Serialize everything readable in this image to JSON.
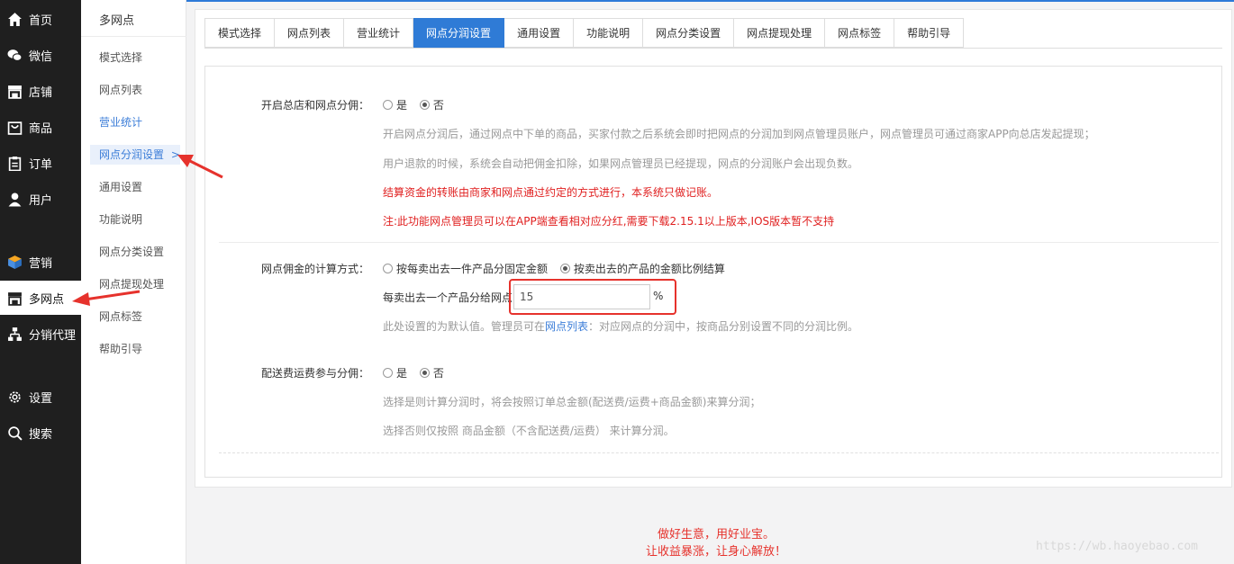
{
  "sidebar": {
    "items": [
      {
        "label": "首页",
        "icon": "home-icon"
      },
      {
        "label": "微信",
        "icon": "wechat-icon"
      },
      {
        "label": "店铺",
        "icon": "store-icon"
      },
      {
        "label": "商品",
        "icon": "shopping-bag-icon"
      },
      {
        "label": "订单",
        "icon": "clipboard-icon"
      },
      {
        "label": "用户",
        "icon": "user-icon"
      },
      {
        "label": "营销",
        "icon": "cube-icon"
      },
      {
        "label": "多网点",
        "icon": "shop-front-icon"
      },
      {
        "label": "分销代理",
        "icon": "org-chart-icon"
      },
      {
        "label": "设置",
        "icon": "gear-icon"
      },
      {
        "label": "搜索",
        "icon": "search-icon"
      }
    ]
  },
  "submenu": {
    "title": "多网点",
    "items": [
      "模式选择",
      "网点列表",
      "营业统计",
      "网点分润设置",
      "通用设置",
      "功能说明",
      "网点分类设置",
      "网点提现处理",
      "网点标签",
      "帮助引导"
    ],
    "active_marker": ">"
  },
  "tabs": [
    "模式选择",
    "网点列表",
    "营业统计",
    "网点分润设置",
    "通用设置",
    "功能说明",
    "网点分类设置",
    "网点提现处理",
    "网点标签",
    "帮助引导"
  ],
  "form": {
    "sec1": {
      "label": "开启总店和网点分佣：",
      "opt_yes": "是",
      "opt_no": "否",
      "hint1": "开启网点分润后，通过网点中下单的商品，买家付款之后系统会即时把网点的分润加到网点管理员账户，网点管理员可通过商家APP向总店发起提现；",
      "hint2": "用户退款的时候，系统会自动把佣金扣除，如果网点管理员已经提现，网点的分润账户会出现负数。",
      "warn1": "结算资金的转账由商家和网点通过约定的方式进行，本系统只做记账。",
      "warn2": "注:此功能网点管理员可以在APP端查看相对应分红,需要下载2.15.1以上版本,IOS版本暂不支持"
    },
    "sec2": {
      "label": "网点佣金的计算方式：",
      "opt_fixed": "按每卖出去一件产品分固定金额",
      "opt_ratio": "按卖出去的产品的金额比例结算",
      "input_label": "每卖出去一个产品分给网点",
      "input_value": "15",
      "unit": "%",
      "hint_pre": "此处设置的为默认值。管理员可在",
      "hint_link": "网点列表",
      "hint_post": "：对应网点的分润中，按商品分别设置不同的分润比例。"
    },
    "sec3": {
      "label": "配送费运费参与分佣：",
      "opt_yes": "是",
      "opt_no": "否",
      "hint1": "选择是则计算分润时，将会按照订单总金额(配送费/运费+商品金额)来算分润；",
      "hint2": "选择否则仅按照 商品金额（不含配送费/运费） 来计算分润。"
    }
  },
  "footer": {
    "line1": "做好生意，用好业宝。",
    "line2": "让收益暴涨，让身心解放！"
  },
  "watermark": "https://wb.haoyebao.com",
  "colors": {
    "accent": "#2f7bd6",
    "warning": "#e02020",
    "sidebar_bg": "#1f1f1f",
    "annotation_red": "#e6322c"
  }
}
